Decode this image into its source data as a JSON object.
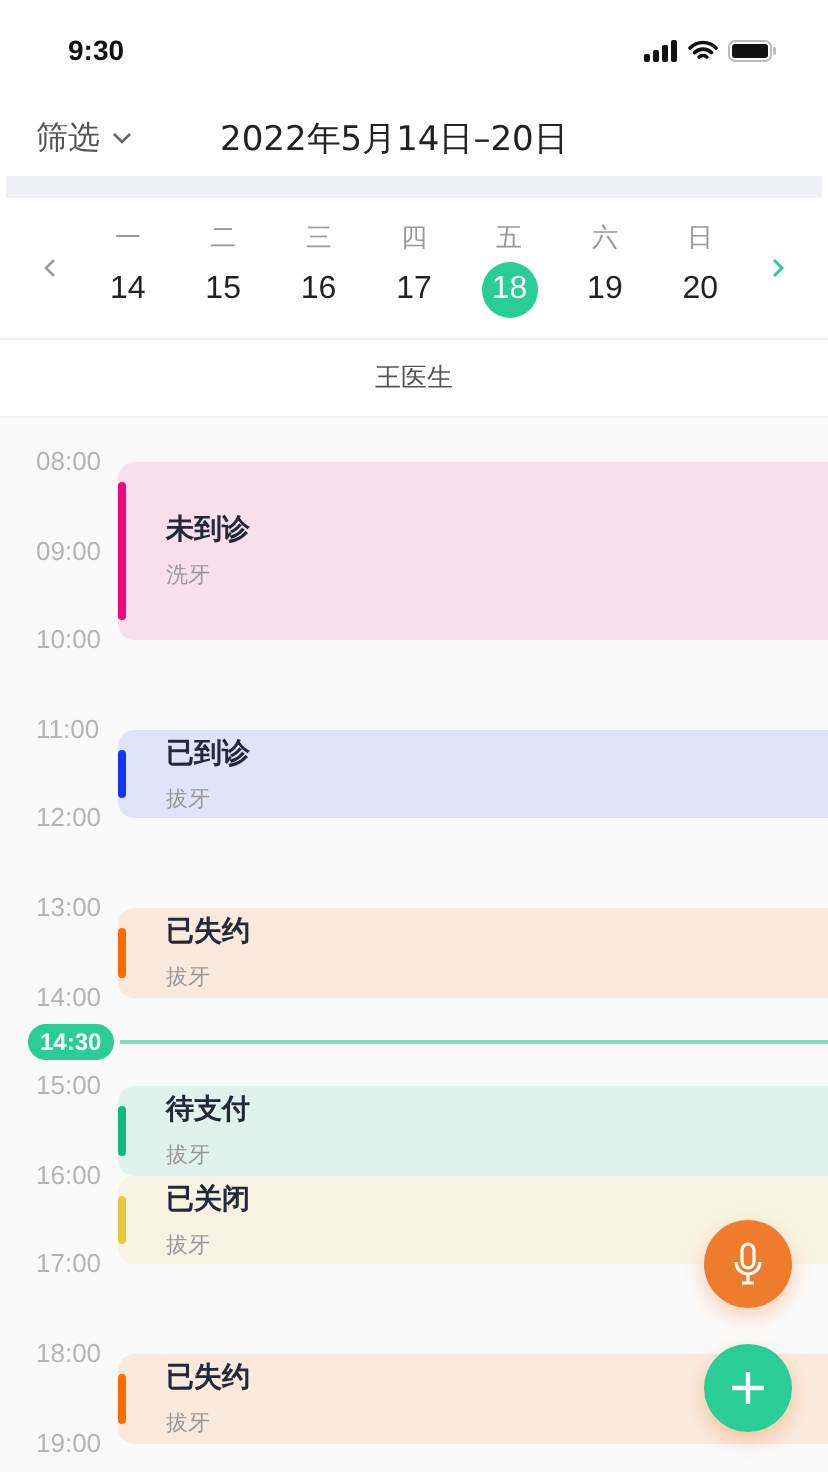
{
  "status_bar": {
    "time": "9:30"
  },
  "header": {
    "filter": "筛选",
    "title": "2022年5月14日–20日"
  },
  "week": [
    {
      "weekday": "一",
      "date": "14",
      "selected": false
    },
    {
      "weekday": "二",
      "date": "15",
      "selected": false
    },
    {
      "weekday": "三",
      "date": "16",
      "selected": false
    },
    {
      "weekday": "四",
      "date": "17",
      "selected": false
    },
    {
      "weekday": "五",
      "date": "18",
      "selected": true
    },
    {
      "weekday": "六",
      "date": "19",
      "selected": false
    },
    {
      "weekday": "日",
      "date": "20",
      "selected": false
    }
  ],
  "doctor": "王医生",
  "hours": [
    {
      "label": "08:00",
      "appointment": {
        "status": "未到诊",
        "service": "洗牙",
        "kind": "long",
        "color": "#f0087a"
      }
    },
    {
      "label": "09:00"
    },
    {
      "label": "10:00"
    },
    {
      "label": "11:00",
      "appointment": {
        "status": "已到诊",
        "service": "拔牙",
        "kind": "short",
        "color": "#1435f5"
      }
    },
    {
      "label": "12:00"
    },
    {
      "label": "13:00",
      "appointment": {
        "status": "已失约",
        "service": "拔牙",
        "kind": "short",
        "color": "#ff6a00"
      }
    },
    {
      "label": "14:00",
      "now": "14:30"
    },
    {
      "label": "15:00",
      "appointment": {
        "status": "待支付",
        "service": "拔牙",
        "kind": "short",
        "color": "#10b981"
      }
    },
    {
      "label": "16:00",
      "appointment": {
        "status": "已关闭",
        "service": "拔牙",
        "kind": "short",
        "color": "#e9c53a"
      }
    },
    {
      "label": "17:00"
    },
    {
      "label": "18:00",
      "appointment": {
        "status": "已失约",
        "service": "拔牙",
        "kind": "short",
        "color": "#ff6a00"
      }
    },
    {
      "label": "19:00"
    }
  ]
}
